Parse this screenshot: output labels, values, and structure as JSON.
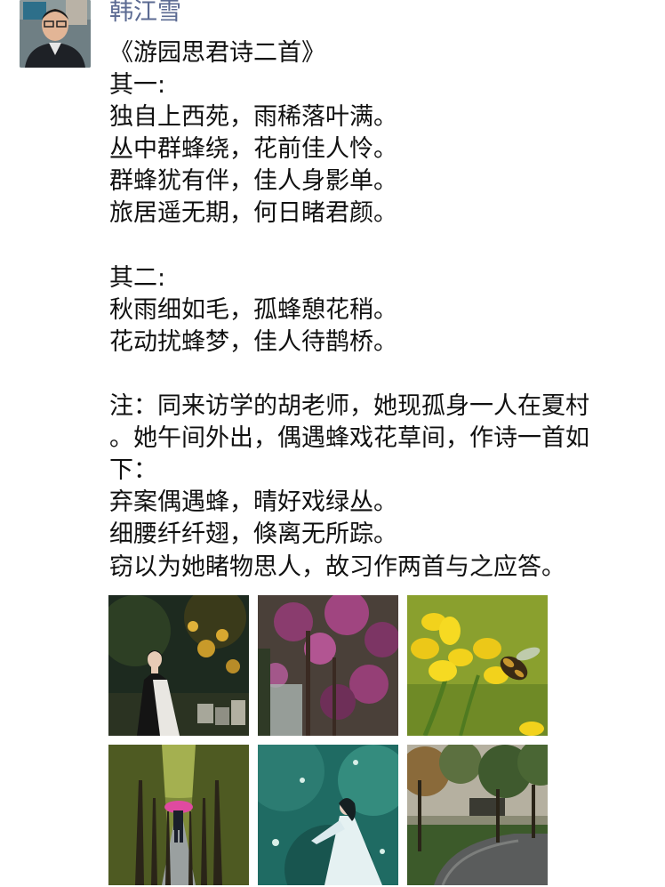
{
  "author": {
    "name": "韩江雪"
  },
  "post": {
    "lines": [
      "《游园思君诗二首》",
      "其一:",
      "独自上西苑，雨稀落叶满。",
      "丛中群蜂绕，花前佳人怜。",
      "群蜂犹有伴，佳人身影单。",
      "旅居遥无期，何日睹君颜。",
      "",
      "其二:",
      "秋雨细如毛，孤蜂憩花稍。",
      "花动扰蜂梦，佳人待鹊桥。",
      "",
      "注：同来访学的胡老师，她现孤身一人在夏村",
      "。她午间外出，偶遇蜂戏花草间，作诗一首如",
      "下：",
      "弃案偶遇蜂，晴好戏绿丛。",
      "细腰纤纤翅，倏离无所踪。",
      "窃以为她睹物思人，故习作两首与之应答。"
    ]
  },
  "photos": [
    {
      "icon": "woman-in-garden-photo"
    },
    {
      "icon": "purple-blossom-photo"
    },
    {
      "icon": "bee-on-yellow-flower-photo"
    },
    {
      "icon": "tree-avenue-pink-umbrella-photo"
    },
    {
      "icon": "woman-in-white-dress-photo"
    },
    {
      "icon": "rainy-park-path-photo"
    }
  ],
  "colors": {
    "author_name": "#5b6a92",
    "text": "#111111"
  }
}
